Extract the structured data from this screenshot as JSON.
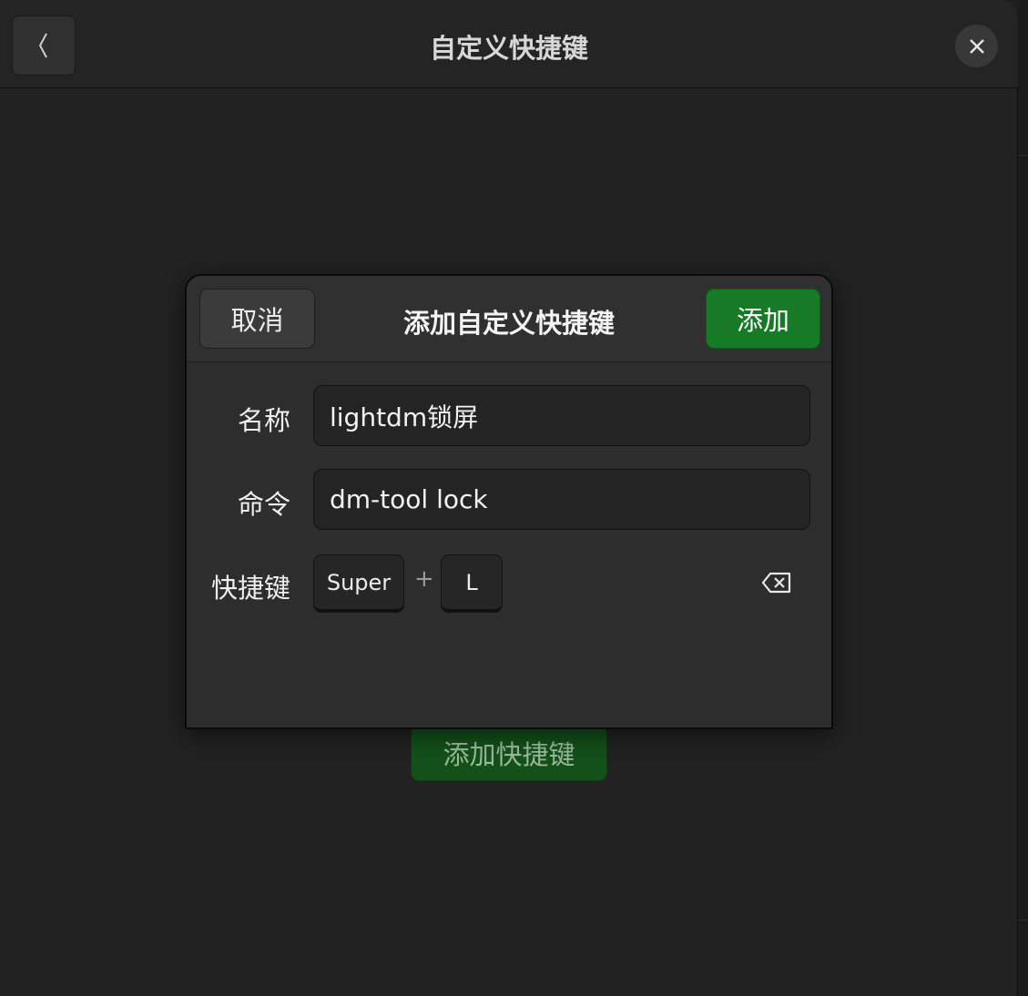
{
  "header": {
    "title": "自定义快捷键",
    "back_icon": "chevron-left-icon",
    "close_icon": "close-icon"
  },
  "main": {
    "add_shortcut_label": "添加快捷键"
  },
  "dialog": {
    "title": "添加自定义快捷键",
    "cancel_label": "取消",
    "add_label": "添加",
    "name_label": "名称",
    "name_value": "lightdm锁屏",
    "command_label": "命令",
    "command_value": "dm-tool lock",
    "shortcut_label": "快捷键",
    "keys": [
      "Super",
      "L"
    ],
    "plus_sign": "+",
    "clear_icon": "backspace-icon"
  },
  "colors": {
    "accent": "#167a26",
    "background": "#222222",
    "dialog": "#2d2d2d"
  }
}
